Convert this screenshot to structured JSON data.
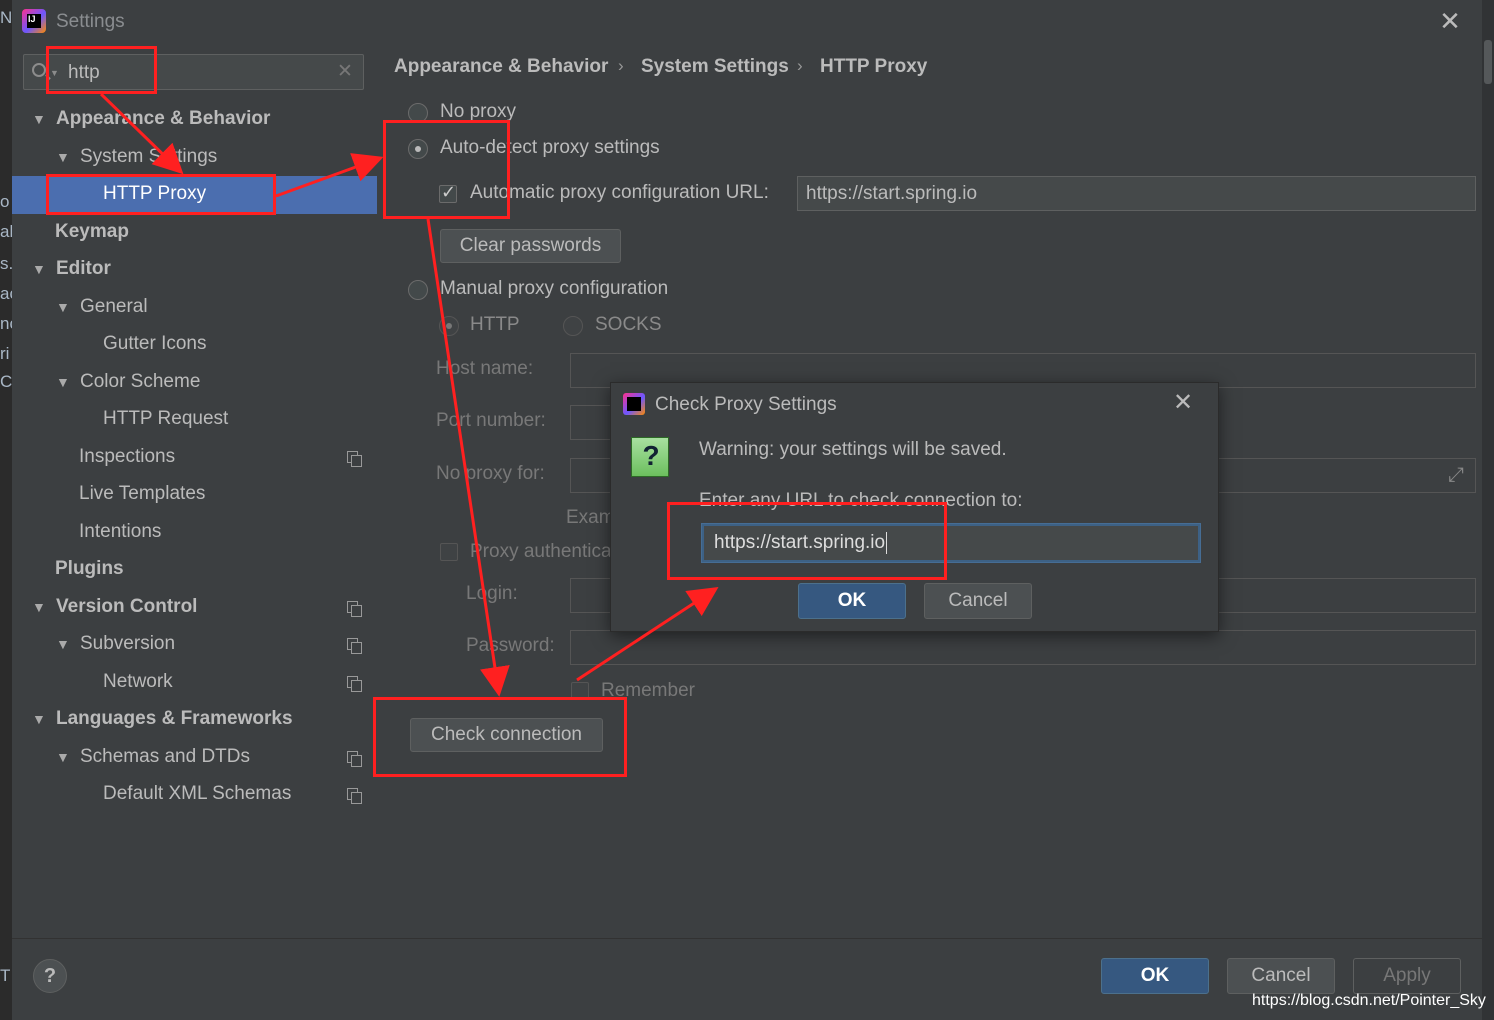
{
  "window": {
    "title": "Settings"
  },
  "search": {
    "value": "http"
  },
  "tree": [
    {
      "label": "Appearance & Behavior"
    },
    {
      "label": "System Settings"
    },
    {
      "label": "HTTP Proxy"
    },
    {
      "label": "Keymap"
    },
    {
      "label": "Editor"
    },
    {
      "label": "General"
    },
    {
      "label": "Gutter Icons"
    },
    {
      "label": "Color Scheme"
    },
    {
      "label": "HTTP Request"
    },
    {
      "label": "Inspections"
    },
    {
      "label": "Live Templates"
    },
    {
      "label": "Intentions"
    },
    {
      "label": "Plugins"
    },
    {
      "label": "Version Control"
    },
    {
      "label": "Subversion"
    },
    {
      "label": "Network"
    },
    {
      "label": "Languages & Frameworks"
    },
    {
      "label": "Schemas and DTDs"
    },
    {
      "label": "Default XML Schemas"
    }
  ],
  "breadcrumb": [
    "Appearance & Behavior",
    "System Settings",
    "HTTP Proxy"
  ],
  "proxy": {
    "no_proxy": "No proxy",
    "auto_detect": "Auto-detect proxy settings",
    "auto_config_url_label": "Automatic proxy configuration URL:",
    "auto_config_url_value": "https://start.spring.io",
    "clear_passwords": "Clear passwords",
    "manual": "Manual proxy configuration",
    "http": "HTTP",
    "socks": "SOCKS",
    "host_name": "Host name:",
    "port_number": "Port number:",
    "no_proxy_for": "No proxy for:",
    "example": "Examp",
    "proxy_auth": "Proxy authenticat",
    "login": "Login:",
    "password": "Password:",
    "remember": "Remember",
    "check_connection": "Check connection"
  },
  "dialog": {
    "title": "Check Proxy Settings",
    "warning": "Warning: your settings will be saved.",
    "prompt": "Enter any URL to check connection to:",
    "url_value": "https://start.spring.io",
    "ok": "OK",
    "cancel": "Cancel"
  },
  "footer": {
    "ok": "OK",
    "cancel": "Cancel",
    "apply": "Apply",
    "help": "?"
  },
  "watermark": "https://blog.csdn.net/Pointer_Sky",
  "ide_fragments": [
    "N",
    "o",
    "al",
    "s.",
    "ac",
    "nc",
    "ri",
    "C",
    "T"
  ]
}
